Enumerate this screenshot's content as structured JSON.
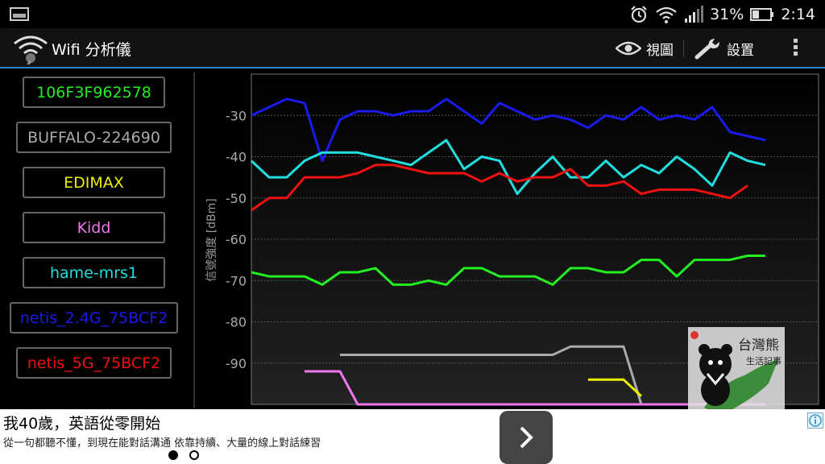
{
  "status_bar": {
    "battery": "31%",
    "time": "2:14",
    "icons": [
      "gallery-icon",
      "alarm-icon",
      "wifi-icon",
      "signal-icon",
      "battery-icon"
    ]
  },
  "action_bar": {
    "title": "Wifi 分析儀",
    "view_label": "視圖",
    "settings_label": "設置",
    "icons": [
      "wifi-logo-icon",
      "eye-icon",
      "wrench-icon",
      "overflow-menu-icon"
    ]
  },
  "networks": [
    {
      "ssid": "106F3F962578",
      "color": "#22ee22"
    },
    {
      "ssid": "BUFFALO-224690",
      "color": "#aaaaaa"
    },
    {
      "ssid": "EDIMAX",
      "color": "#eeee00"
    },
    {
      "ssid": "Kidd",
      "color": "#ee77ee"
    },
    {
      "ssid": "hame-mrs1",
      "color": "#22dddd"
    },
    {
      "ssid": "netis_2.4G_75BCF2",
      "color": "#1a1aee"
    },
    {
      "ssid": "netis_5G_75BCF2",
      "color": "#ee1111"
    }
  ],
  "chart_data": {
    "type": "line",
    "title": "",
    "xlabel": "",
    "ylabel": "信號強度 [dBm]",
    "ylim": [
      -100,
      -20
    ],
    "yticks": [
      -30,
      -40,
      -50,
      -60,
      -70,
      -80,
      -90
    ],
    "ytick_labels": [
      "-30",
      "-40",
      "-50",
      "-60",
      "-70",
      "-80",
      "-90"
    ],
    "grid": true,
    "legend": "none",
    "x": [
      0,
      1,
      2,
      3,
      4,
      5,
      6,
      7,
      8,
      9,
      10,
      11,
      12,
      13,
      14,
      15,
      16,
      17,
      18,
      19,
      20,
      21,
      22,
      23,
      24,
      25,
      26,
      27,
      28,
      29,
      30,
      31,
      32
    ],
    "series": [
      {
        "name": "netis_2.4G_75BCF2",
        "color": "#1a1aee",
        "values": [
          -30,
          -28,
          -26,
          -27,
          -41,
          -31,
          -29,
          -29,
          -30,
          -29,
          -29,
          -26,
          -29,
          -32,
          -27,
          -29,
          -31,
          -30,
          -31,
          -33,
          -30,
          -31,
          -28,
          -31,
          -30,
          -31,
          -28,
          -34,
          -35,
          -36,
          null,
          null,
          null
        ]
      },
      {
        "name": "hame-mrs1",
        "color": "#22dddd",
        "values": [
          -41,
          -45,
          -45,
          -41,
          -39,
          -39,
          -39,
          -40,
          -41,
          -42,
          -39,
          -36,
          -43,
          -40,
          -41,
          -49,
          -44,
          -40,
          -45,
          -45,
          -41,
          -45,
          -42,
          -44,
          -40,
          -43,
          -47,
          -39,
          -41,
          -42,
          null,
          null,
          null
        ]
      },
      {
        "name": "netis_5G_75BCF2",
        "color": "#ee1111",
        "values": [
          -53,
          -50,
          -50,
          -45,
          -45,
          -45,
          -44,
          -42,
          -42,
          -43,
          -44,
          -44,
          -44,
          -46,
          -44,
          -46,
          -45,
          -45,
          -43,
          -47,
          -47,
          -46,
          -49,
          -48,
          -48,
          -48,
          -49,
          -50,
          -47,
          null,
          null,
          null,
          null
        ]
      },
      {
        "name": "106F3F962578",
        "color": "#22ee22",
        "values": [
          -68,
          -69,
          -69,
          -69,
          -71,
          -68,
          -68,
          -67,
          -71,
          -71,
          -70,
          -71,
          -67,
          -67,
          -69,
          -69,
          -69,
          -71,
          -67,
          -67,
          -68,
          -68,
          -65,
          -65,
          -69,
          -65,
          -65,
          -65,
          -64,
          -64,
          null,
          null,
          null
        ]
      },
      {
        "name": "BUFFALO-224690",
        "color": "#aaaaaa",
        "values": [
          null,
          null,
          null,
          null,
          null,
          -88,
          -88,
          -88,
          -88,
          -88,
          -88,
          -88,
          -88,
          -88,
          -88,
          -88,
          -88,
          -88,
          -86,
          -86,
          -86,
          -86,
          -100,
          null,
          null,
          null,
          null,
          null,
          null,
          null,
          null,
          null,
          null
        ]
      },
      {
        "name": "Kidd",
        "color": "#ee77ee",
        "values": [
          null,
          null,
          null,
          -92,
          -92,
          -92,
          -100,
          -100,
          -100,
          -100,
          -100,
          -100,
          -100,
          -100,
          -100,
          -100,
          -100,
          -100,
          -100,
          -100,
          -100,
          -100,
          -100,
          -100,
          -100,
          -100,
          -100,
          -100,
          -100,
          -100,
          null,
          null,
          null
        ]
      },
      {
        "name": "EDIMAX",
        "color": "#eeee00",
        "values": [
          null,
          null,
          null,
          null,
          null,
          null,
          null,
          null,
          null,
          null,
          null,
          null,
          null,
          null,
          null,
          null,
          null,
          null,
          null,
          -94,
          -94,
          -94,
          -98,
          null,
          null,
          null,
          null,
          null,
          null,
          null,
          null,
          null,
          null
        ]
      }
    ]
  },
  "watermark": {
    "text": "台灣熊",
    "subtext": "生活記事"
  },
  "ad": {
    "headline": "我40歲，英語從零開始",
    "subtext": "從一句都聽不懂，到現在能對話溝通 依靠持續、大量的線上對話練習",
    "icons": [
      "chevron-right-icon",
      "ad-choices-icon"
    ]
  }
}
